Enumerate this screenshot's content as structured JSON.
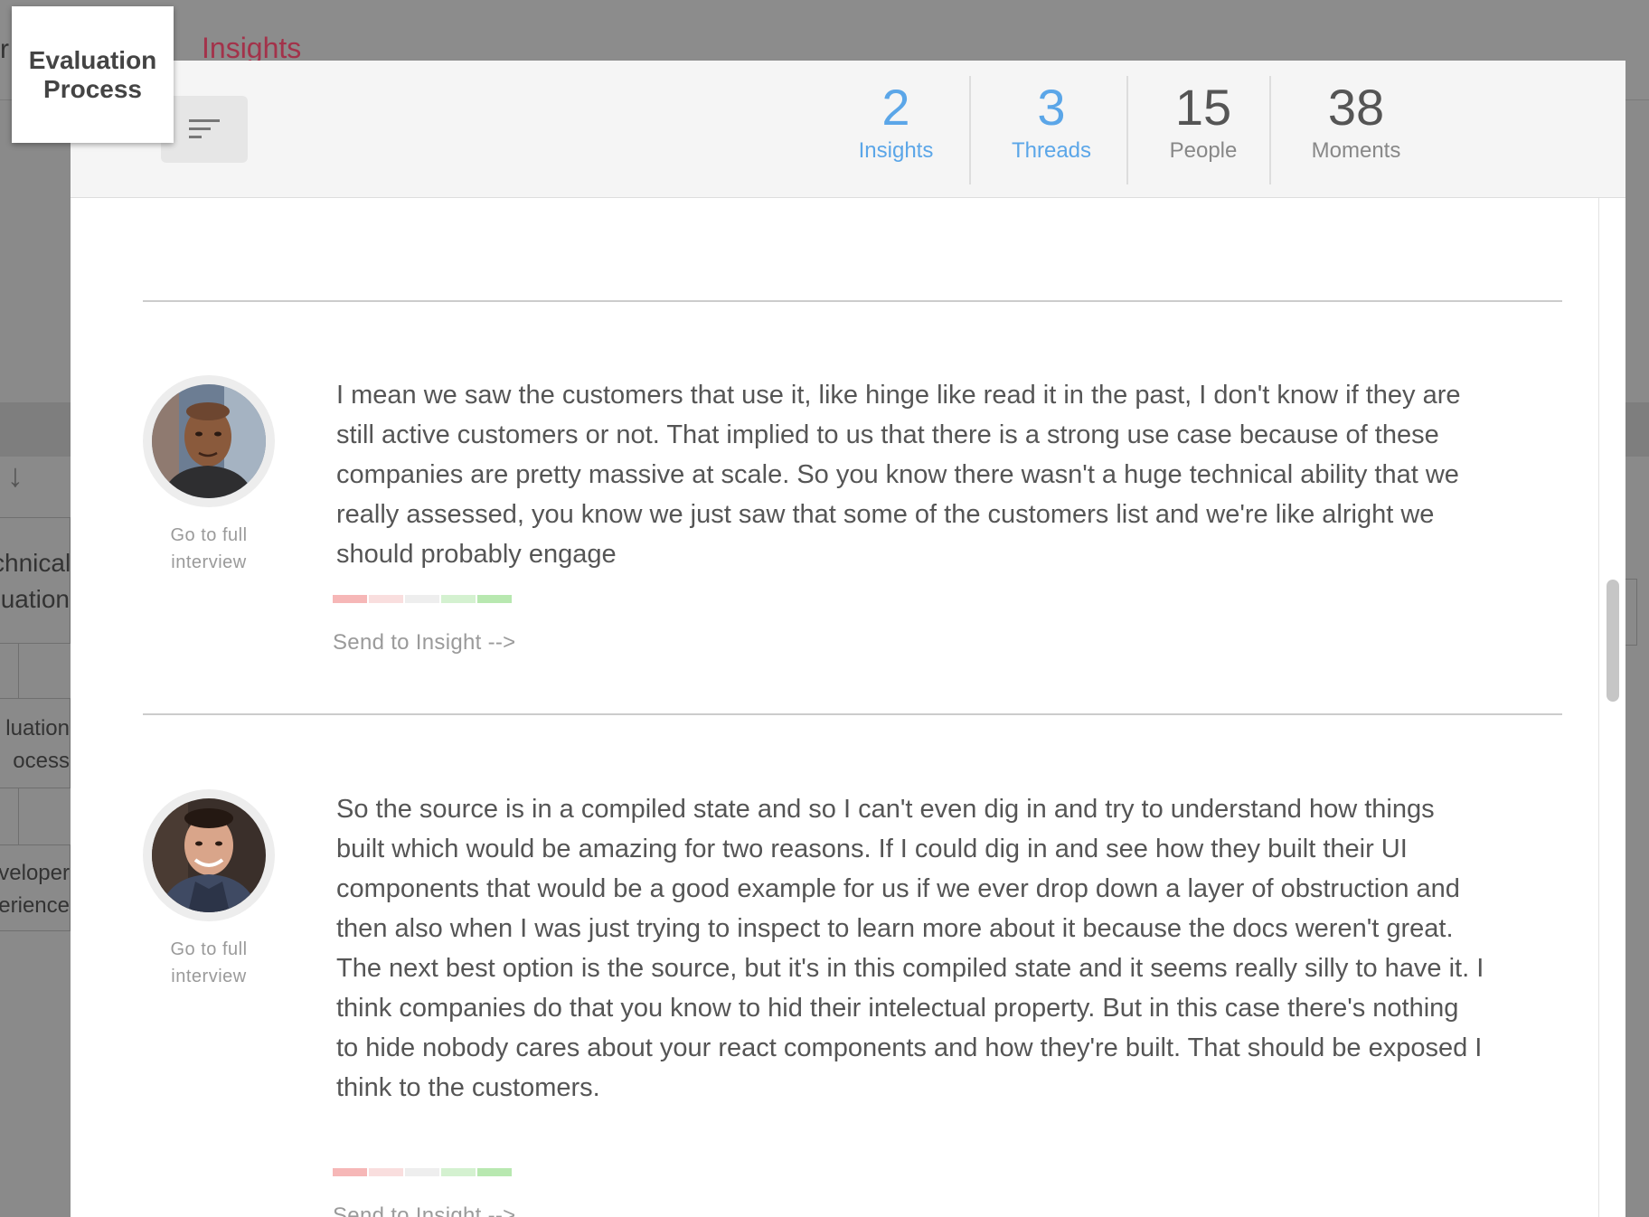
{
  "background": {
    "tab_fragment": "r",
    "insights_tab": "Insights",
    "cards": [
      {
        "line1": "chnical",
        "line2": "luation"
      },
      {
        "line1": "luation",
        "line2": "ocess"
      },
      {
        "line1": "veloper",
        "line2": "erience"
      }
    ]
  },
  "process_label": "Evaluation Process",
  "stats": [
    {
      "value": "2",
      "label": "Insights"
    },
    {
      "value": "3",
      "label": "Threads"
    },
    {
      "value": "15",
      "label": "People"
    },
    {
      "value": "38",
      "label": "Moments"
    }
  ],
  "moments": [
    {
      "avatar_icon": "person-photo",
      "link": "Go to full interview",
      "quote": "I mean we saw the customers that use it, like hinge like read it in the past, I don't know if they are still active customers or not. That implied to us that there is a strong use case because of these companies are pretty massive at scale. So you know there wasn't a huge technical ability that we really assessed, you know we just saw that some of the customers list and we're like alright we should probably engage",
      "send": "Send to Insight -->"
    },
    {
      "avatar_icon": "person-photo",
      "link": "Go to full interview",
      "quote": "So the source is in a compiled state and so I can't even dig in and try to understand how things built which would be amazing for two reasons. If I could dig in and see how they built their UI components that would be a good example for us if we ever drop down a layer of obstruction and then also when I was just trying to inspect to learn more about it because the docs weren't great. The next best option is the source, but it's in this compiled state and it seems really silly to have it. I think companies do that you know to hid their intelectual property. But in this case there's nothing to hide nobody cares about your react components and how they're built. That should be exposed I think to the customers.",
      "send": "Send to Insight -->"
    }
  ],
  "colors": {
    "accent_blue": "#5ba6e8",
    "insights_tab": "#a3324a",
    "sentiment": [
      "#f6b7b7",
      "#f9dede",
      "#eeeeee",
      "#d4f1d0",
      "#b8e8b0"
    ]
  }
}
